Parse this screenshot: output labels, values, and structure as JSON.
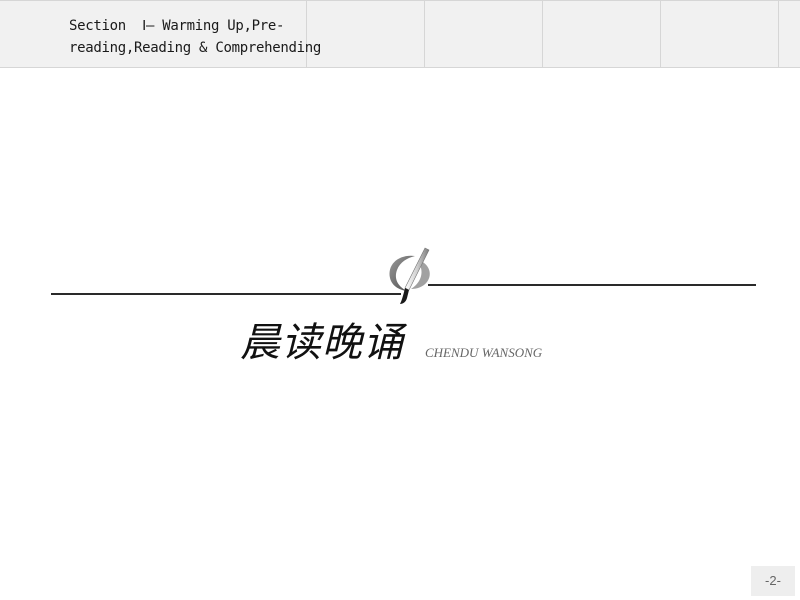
{
  "header": {
    "title_line1": "Section  Ⅰ— Warming Up,Pre-",
    "title_line2": "reading,Reading & Comprehending"
  },
  "main": {
    "title_cn": "晨读晚诵",
    "title_en": "CHENDU WANSONG",
    "emblem_icon": "pen-brush-icon"
  },
  "footer": {
    "page_number": "-2-"
  }
}
